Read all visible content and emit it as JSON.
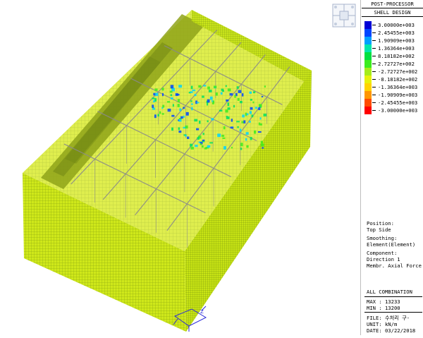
{
  "panel": {
    "title1": "POST-PROCESSOR",
    "title2": "SHELL DESIGN",
    "legend": [
      {
        "value": "3.00000e+003",
        "color": "#0000d6"
      },
      {
        "value": "2.45455e+003",
        "color": "#0046ff"
      },
      {
        "value": "1.90909e+003",
        "color": "#00a0ff"
      },
      {
        "value": "1.36364e+003",
        "color": "#00e6aa"
      },
      {
        "value": "8.18182e+002",
        "color": "#00e040"
      },
      {
        "value": "2.72727e+002",
        "color": "#3cec1e"
      },
      {
        "value": "-2.72727e+002",
        "color": "#a6ec1a"
      },
      {
        "value": "-8.18182e+002",
        "color": "#e6f20c"
      },
      {
        "value": "-1.36364e+003",
        "color": "#ffd400"
      },
      {
        "value": "-1.90909e+003",
        "color": "#ff9600"
      },
      {
        "value": "-2.45455e+003",
        "color": "#ff4c00"
      },
      {
        "value": "-3.00000e+003",
        "color": "#ff0000"
      }
    ],
    "position_label": "Position:",
    "position_value": "Top Side",
    "smoothing_label": "Smoothing:",
    "smoothing_value": "Element(Element)",
    "component_label": "Component:",
    "component_value1": "Direction 1",
    "component_value2": "Membr. Axial Force",
    "combination": "ALL COMBINATION",
    "max": "MAX : 13233",
    "min": "MIN : 13200",
    "file": "FILE: 수처리 구-",
    "unit": "UNIT: kN/m",
    "date": "DATE: 03/22/2018"
  },
  "view": {
    "wall_color": "#cfe81a",
    "top_color": "#b6d414",
    "mesh_color": "#6e8a10",
    "frame_color": "#8a8a8a",
    "hot_colors": [
      "#00d4ff",
      "#00e060",
      "#3cec1e",
      "#0046ff"
    ]
  }
}
